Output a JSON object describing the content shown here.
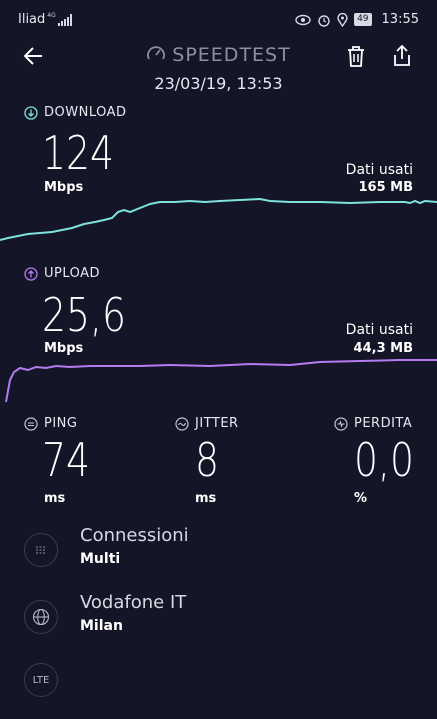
{
  "status_bar": {
    "carrier": "Iliad",
    "network": "4G",
    "battery": "49",
    "time": "13:55"
  },
  "header": {
    "title": "SPEEDTEST",
    "datetime": "23/03/19, 13:53"
  },
  "download": {
    "label": "DOWNLOAD",
    "value": "124",
    "unit": "Mbps",
    "data_used_label": "Dati usati",
    "data_used_value": "165 MB",
    "color": "#7fe3dc"
  },
  "upload": {
    "label": "UPLOAD",
    "value": "25,6",
    "unit": "Mbps",
    "data_used_label": "Dati usati",
    "data_used_value": "44,3 MB",
    "color": "#b47cf0"
  },
  "metrics": {
    "ping": {
      "label": "PING",
      "value": "74",
      "unit": "ms"
    },
    "jitter": {
      "label": "JITTER",
      "value": "8",
      "unit": "ms"
    },
    "loss": {
      "label": "PERDITA",
      "value": "0,0",
      "unit": "%"
    }
  },
  "connections": {
    "title": "Connessioni",
    "value": "Multi"
  },
  "provider": {
    "title": "Vodafone IT",
    "value": "Milan"
  },
  "network_type": {
    "icon_label": "LTE"
  }
}
